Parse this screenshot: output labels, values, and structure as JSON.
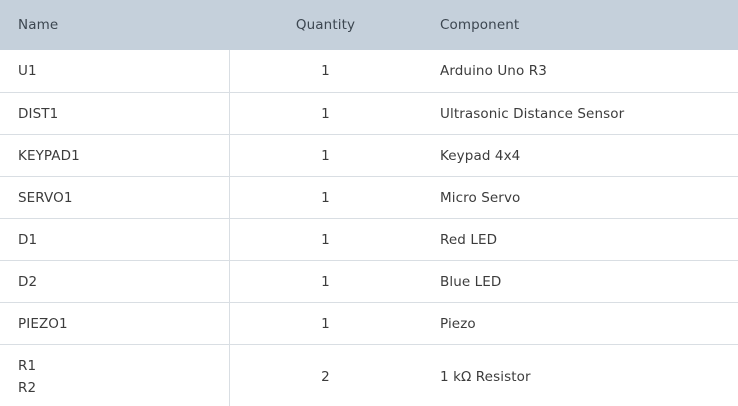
{
  "headers": {
    "name": "Name",
    "quantity": "Quantity",
    "component": "Component"
  },
  "rows": [
    {
      "name": "U1",
      "quantity": "1",
      "component": "Arduino Uno R3"
    },
    {
      "name": "DIST1",
      "quantity": "1",
      "component": "Ultrasonic Distance Sensor"
    },
    {
      "name": "KEYPAD1",
      "quantity": "1",
      "component": "Keypad 4x4"
    },
    {
      "name": "SERVO1",
      "quantity": "1",
      "component": "Micro Servo"
    },
    {
      "name": "D1",
      "quantity": "1",
      "component": "Red LED"
    },
    {
      "name": "D2",
      "quantity": "1",
      "component": "Blue LED"
    },
    {
      "name": "PIEZO1",
      "quantity": "1",
      "component": "Piezo"
    },
    {
      "names": [
        "R1",
        "R2"
      ],
      "quantity": "2",
      "component": "1 kΩ Resistor"
    }
  ]
}
